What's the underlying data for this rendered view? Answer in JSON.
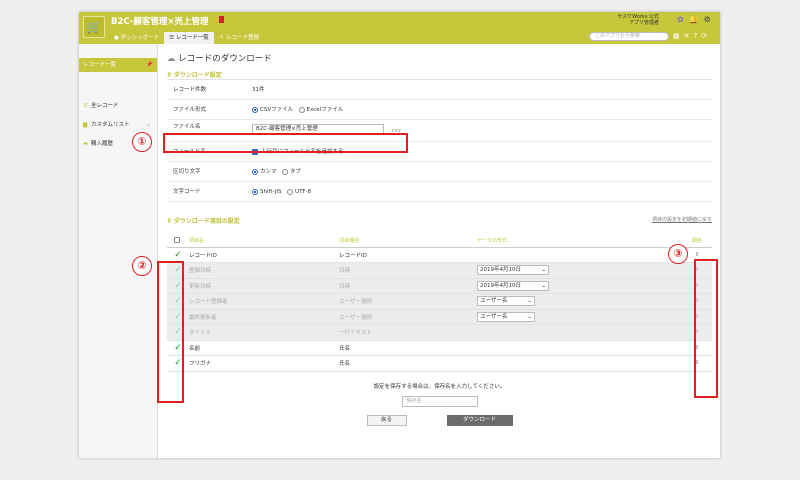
{
  "header": {
    "app_title": "B2C-顧客管理×売上管理",
    "tabs": [
      "ダッシュボード",
      "レコード一覧",
      "レコード登録"
    ],
    "user_line1": "サスケWorks 公式",
    "user_line2": "アプリ管理者",
    "search_placeholder": "このアプリから検索"
  },
  "sidebar": {
    "head": "レコード一覧",
    "items": [
      "全レコード",
      "カスタムリスト",
      "購入履歴"
    ]
  },
  "main": {
    "title": "レコードのダウンロード",
    "section1": "ダウンロード設定",
    "count_label": "レコード件数",
    "count_value": "31件",
    "format_label": "ファイル形式",
    "format_options": [
      "CSVファイル",
      "Excelファイル"
    ],
    "filename_label": "ファイル名",
    "filename_value": "B2C-顧客管理×売上管理",
    "filename_ext": ".csv",
    "fieldname_label": "フィールド名",
    "fieldname_option": "１行目にフィールド名を追加する",
    "delimiter_label": "区切り文字",
    "delimiter_options": [
      "カンマ",
      "タブ"
    ],
    "encoding_label": "文字コード",
    "encoding_options": [
      "Shift-JIS",
      "UTF-8"
    ],
    "section2": "ダウンロード項目の設定",
    "reset_link": "項目の設定を初期値に戻す",
    "col_headers": [
      "項目名",
      "項目種別",
      "データの形式",
      "順序"
    ],
    "rows": [
      {
        "name": "レコードID",
        "type": "レコードID",
        "format": ""
      },
      {
        "name": "登録日時",
        "type": "日時",
        "format": "2019年4月10日"
      },
      {
        "name": "更新日時",
        "type": "日時",
        "format": "2019年4月10日"
      },
      {
        "name": "レコード登録者",
        "type": "ユーザー選択",
        "format": "ユーザー名"
      },
      {
        "name": "最終更新者",
        "type": "ユーザー選択",
        "format": "ユーザー名"
      },
      {
        "name": "タイトル",
        "type": "一行テキスト",
        "format": ""
      },
      {
        "name": "名前",
        "type": "氏名",
        "format": ""
      },
      {
        "name": "フリガナ",
        "type": "氏名",
        "format": ""
      }
    ],
    "save_note": "設定を保存する場合は、保存名を入力してください。",
    "save_placeholder": "保存名",
    "back_button": "戻る",
    "download_button": "ダウンロード"
  },
  "annotations": [
    "①",
    "②",
    "③"
  ]
}
